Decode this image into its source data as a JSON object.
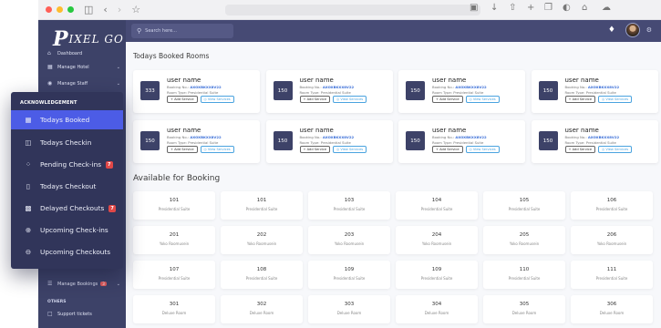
{
  "app": {
    "logo_text": "IXEL GO",
    "logo_initial": "P"
  },
  "colors": {
    "sidebar": "#3d4268",
    "topbar": "#464a74",
    "popover": "#31355a",
    "active": "#4c5ce6",
    "badge": "#e04848",
    "link": "#3b6fd8"
  },
  "sidebar": {
    "items": [
      {
        "label": "Dashboard",
        "icon": "home-icon"
      },
      {
        "label": "Manage Hotel",
        "icon": "building-icon"
      },
      {
        "label": "Manage Staff",
        "icon": "users-icon"
      }
    ],
    "manage_bookings": {
      "label": "Manage Bookings",
      "badge": "3",
      "icon": "list-icon"
    },
    "others_heading": "OTHERS",
    "support": {
      "label": "Support tickets",
      "icon": "ticket-icon"
    }
  },
  "topbar": {
    "search_placeholder": "Search here...",
    "bell_icon": "bell-icon",
    "gear_icon": "gear-icon"
  },
  "todays_booked": {
    "title": "Todays Booked Rooms",
    "cards": [
      {
        "room": "333",
        "user": "user name",
        "booking_label": "Booking No.:",
        "booking_no": "AXOXBKXX8V22",
        "room_type": "Room Type: Presidential Suite",
        "add": "+ Add Service",
        "view": "◎ View Services"
      },
      {
        "room": "150",
        "user": "user name",
        "booking_label": "Booking No.:",
        "booking_no": "AXOXBKXX8V22",
        "room_type": "Room Type: Presidential Suite",
        "add": "+ Add Service",
        "view": "◎ View Services"
      },
      {
        "room": "150",
        "user": "user name",
        "booking_label": "Booking No.:",
        "booking_no": "AXOXBKXX8V22",
        "room_type": "Room Type: Presidential Suite",
        "add": "+ Add Service",
        "view": "◎ View Services"
      },
      {
        "room": "150",
        "user": "user name",
        "booking_label": "Booking No.:",
        "booking_no": "AXOXBKXX8V22",
        "room_type": "Room Type: Presidential Suite",
        "add": "+ Add Service",
        "view": "◎ View Services"
      },
      {
        "room": "150",
        "user": "user name",
        "booking_label": "Booking No.:",
        "booking_no": "AXOXBKXX8V22",
        "room_type": "Room Type: Presidential Suite",
        "add": "+ Add Service",
        "view": "◎ View Services"
      },
      {
        "room": "150",
        "user": "user name",
        "booking_label": "Booking No.:",
        "booking_no": "AXOXBKXX8V22",
        "room_type": "Room Type: Presidential Suite",
        "add": "+ Add Service",
        "view": "◎ View Services"
      },
      {
        "room": "150",
        "user": "user name",
        "booking_label": "Booking No.:",
        "booking_no": "AXOXBKXX8V22",
        "room_type": "Room Type: Presidential Suite",
        "add": "+ Add Service",
        "view": "◎ View Services"
      },
      {
        "room": "150",
        "user": "user name",
        "booking_label": "Booking No.:",
        "booking_no": "AXOXBKXX8V22",
        "room_type": "Room Type: Presidential Suite",
        "add": "+ Add Service",
        "view": "◎ View Services"
      }
    ]
  },
  "available": {
    "title": "Available for Booking",
    "rooms": [
      {
        "no": "101",
        "type": "Presidential Suite"
      },
      {
        "no": "101",
        "type": "Presidential Suite"
      },
      {
        "no": "103",
        "type": "Presidential Suite"
      },
      {
        "no": "104",
        "type": "Presidential Suite"
      },
      {
        "no": "105",
        "type": "Presidential Suite"
      },
      {
        "no": "106",
        "type": "Presidential Suite"
      },
      {
        "no": "201",
        "type": "Yoko Roomusein"
      },
      {
        "no": "202",
        "type": "Yoko Roomusein"
      },
      {
        "no": "203",
        "type": "Yoko Roomusein"
      },
      {
        "no": "204",
        "type": "Yoko Roomusein"
      },
      {
        "no": "205",
        "type": "Yoko Roomusein"
      },
      {
        "no": "206",
        "type": "Yoko Roomusein"
      },
      {
        "no": "107",
        "type": "Presidential Suite"
      },
      {
        "no": "108",
        "type": "Presidential Suite"
      },
      {
        "no": "109",
        "type": "Presidential Suite"
      },
      {
        "no": "109",
        "type": "Presidential Suite"
      },
      {
        "no": "110",
        "type": "Presidential Suite"
      },
      {
        "no": "111",
        "type": "Presidential Suite"
      },
      {
        "no": "301",
        "type": "Deluxe Room"
      },
      {
        "no": "302",
        "type": "Deluxe Room"
      },
      {
        "no": "303",
        "type": "Deluxe Room"
      },
      {
        "no": "304",
        "type": "Deluxe Room"
      },
      {
        "no": "305",
        "type": "Deluxe Room"
      },
      {
        "no": "306",
        "type": "Deluxe Room"
      }
    ]
  },
  "popover": {
    "heading": "ACKNOWLEDGEMENT",
    "items": [
      {
        "label": "Todays Booked",
        "icon": "calendar-icon",
        "active": true
      },
      {
        "label": "Todays Checkin",
        "icon": "door-in-icon"
      },
      {
        "label": "Pending Check-ins",
        "icon": "spinner-icon",
        "badge": "7"
      },
      {
        "label": "Todays Checkout",
        "icon": "door-out-icon"
      },
      {
        "label": "Delayed Checkouts",
        "icon": "calendar-x-icon",
        "badge": "7"
      },
      {
        "label": "Upcoming Check-ins",
        "icon": "arrow-in-circle-icon"
      },
      {
        "label": "Upcoming Checkouts",
        "icon": "arrow-out-circle-icon"
      }
    ]
  }
}
